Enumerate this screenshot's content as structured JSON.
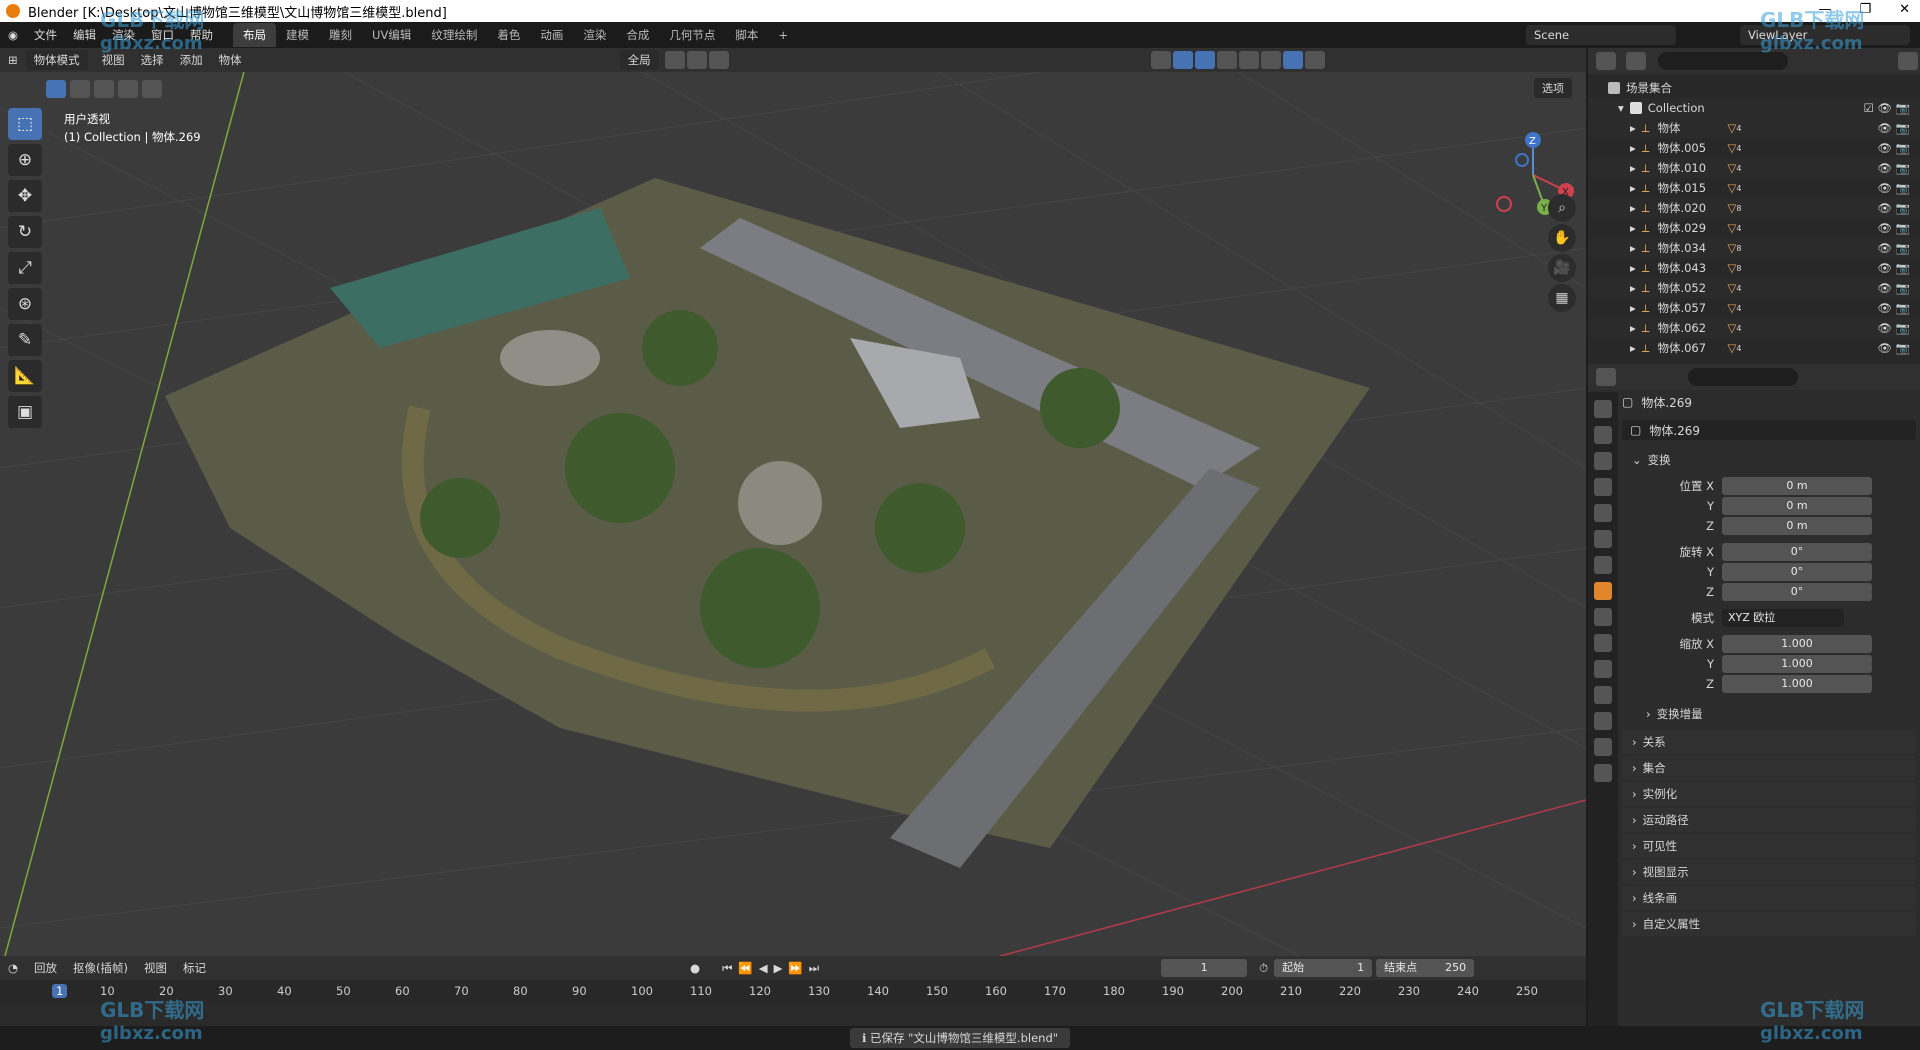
{
  "window": {
    "title": "Blender [K:\\Desktop\\文山博物馆三维模型\\文山博物馆三维模型.blend]",
    "controls": [
      "—",
      "❐",
      "✕"
    ]
  },
  "menu": [
    "文件",
    "编辑",
    "渲染",
    "窗口",
    "帮助"
  ],
  "workspaces": [
    "布局",
    "建模",
    "雕刻",
    "UV编辑",
    "纹理绘制",
    "着色",
    "动画",
    "渲染",
    "合成",
    "几何节点",
    "脚本"
  ],
  "scene": {
    "scene_name": "Scene",
    "view_layer": "ViewLayer",
    "add_tab": "+"
  },
  "viewport": {
    "mode": "物体模式",
    "menus": [
      "视图",
      "选择",
      "添加",
      "物体"
    ],
    "orientation": "全局",
    "options": "选项",
    "view_name": "用户透视",
    "collection_info": "(1) Collection | 物体.269",
    "axes": {
      "x": "X",
      "y": "Y",
      "z": "Z"
    }
  },
  "outliner": {
    "root": "场景集合",
    "collection": "Collection",
    "items": [
      {
        "name": "物体",
        "count": "4"
      },
      {
        "name": "物体.005",
        "count": "4"
      },
      {
        "name": "物体.010",
        "count": "4"
      },
      {
        "name": "物体.015",
        "count": "4"
      },
      {
        "name": "物体.020",
        "count": "8"
      },
      {
        "name": "物体.029",
        "count": "4"
      },
      {
        "name": "物体.034",
        "count": "8"
      },
      {
        "name": "物体.043",
        "count": "8"
      },
      {
        "name": "物体.052",
        "count": "4"
      },
      {
        "name": "物体.057",
        "count": "4"
      },
      {
        "name": "物体.062",
        "count": "4"
      },
      {
        "name": "物体.067",
        "count": "4"
      }
    ]
  },
  "properties": {
    "object_name": "物体.269",
    "data_name": "物体.269",
    "transform": "变换",
    "location_label": "位置 X",
    "rotation_label": "旋转 X",
    "scale_label": "缩放 X",
    "y": "Y",
    "z": "Z",
    "loc": [
      "0 m",
      "0 m",
      "0 m"
    ],
    "rot": [
      "0°",
      "0°",
      "0°"
    ],
    "mode_label": "模式",
    "mode_value": "XYZ 欧拉",
    "scale": [
      "1.000",
      "1.000",
      "1.000"
    ],
    "delta": "变换增量",
    "sections": [
      "关系",
      "集合",
      "实例化",
      "运动路径",
      "可见性",
      "视图显示",
      "线条画",
      "自定义属性"
    ]
  },
  "timeline": {
    "menus": [
      "回放",
      "抠像(插帧)",
      "视图",
      "标记"
    ],
    "current_frame": "1",
    "start_label": "起始",
    "start": "1",
    "end_label": "结束点",
    "end": "250",
    "ticks": [
      "1",
      "10",
      "20",
      "30",
      "40",
      "50",
      "60",
      "70",
      "80",
      "90",
      "100",
      "110",
      "120",
      "130",
      "140",
      "150",
      "160",
      "170",
      "180",
      "190",
      "200",
      "210",
      "220",
      "230",
      "240",
      "250"
    ]
  },
  "status": {
    "message": "已保存 \"文山博物馆三维模型.blend\""
  },
  "watermark": {
    "text1": "GLB下载网",
    "text2": "glbxz.com"
  }
}
